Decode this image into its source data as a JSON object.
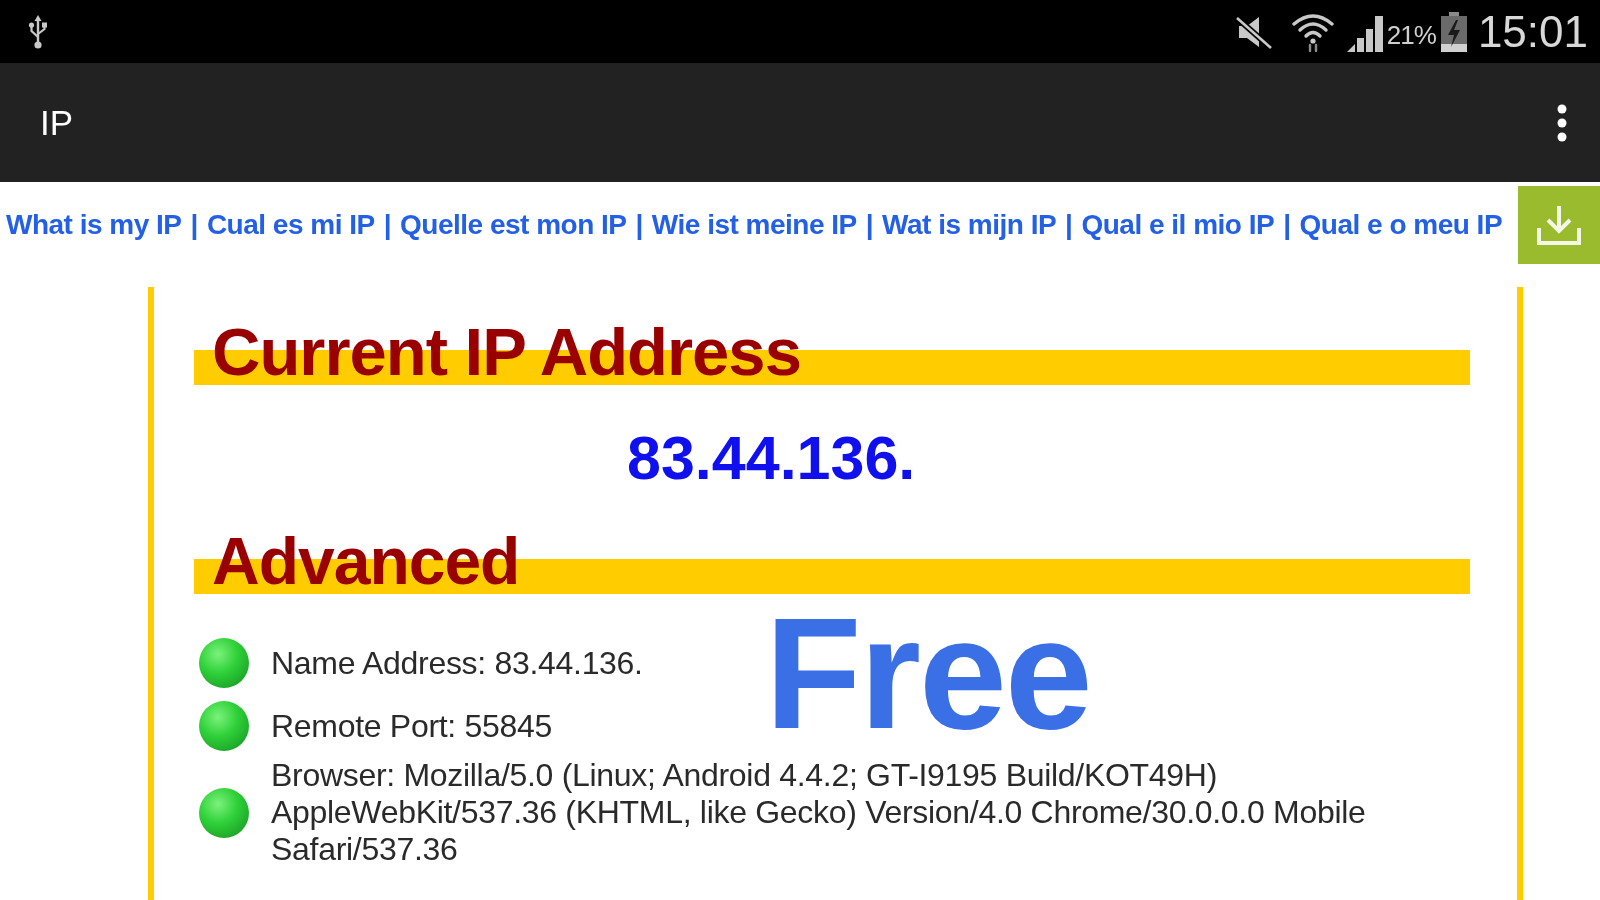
{
  "status_bar": {
    "battery": "21%",
    "time": "15:01"
  },
  "app_bar": {
    "title": "IP"
  },
  "language_links": [
    {
      "text": "What is my IP",
      "separator": "|"
    },
    {
      "text": "Cual es mi IP",
      "separator": "|"
    },
    {
      "text": "Quelle est mon IP",
      "separator": "|"
    },
    {
      "text": "Wie ist meine IP",
      "separator": "|"
    },
    {
      "text": "Wat is mijn IP",
      "separator": "|"
    },
    {
      "text": "Qual e il mio IP",
      "separator": "|"
    },
    {
      "text": "Qual e o meu IP"
    }
  ],
  "current_ip": {
    "heading": "Current IP Address",
    "address": "83.44.136."
  },
  "advanced": {
    "heading": "Advanced",
    "items": [
      "Name Address: 83.44.136.",
      "Remote Port: 55845",
      "Browser: Mozilla/5.0 (Linux; Android 4.4.2; GT-I9195 Build/KOT49H) AppleWebKit/537.36 (KHTML, like Gecko) Version/4.0 Chrome/30.0.0.0 Mobile Safari/537.36"
    ]
  },
  "promo_label": "Free"
}
